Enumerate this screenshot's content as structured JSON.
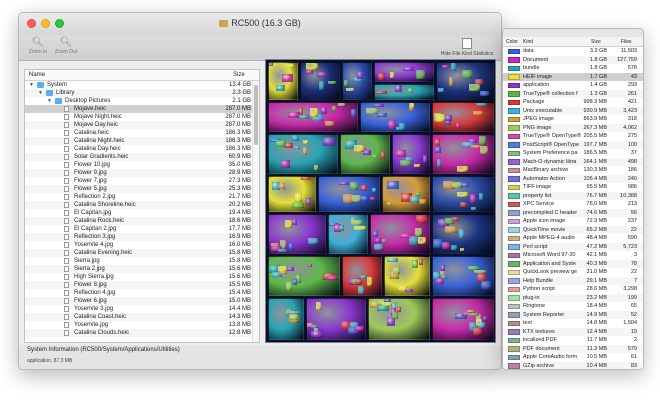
{
  "window": {
    "title": "RC500 (16.3 GB)"
  },
  "toolbar": {
    "zoom_in_label": "Zoom In",
    "zoom_out_label": "Zoom Out",
    "hide_kind_stats_label": "Hide File Kind Statistics"
  },
  "tree": {
    "header": {
      "name": "Name",
      "size": "Size"
    },
    "rows": [
      {
        "depth": 0,
        "type": "folder",
        "name": "System",
        "size": "13.4 GB",
        "twisty": "▼"
      },
      {
        "depth": 1,
        "type": "folder",
        "name": "Library",
        "size": "2.3 GB",
        "twisty": "▼"
      },
      {
        "depth": 2,
        "type": "folder",
        "name": "Desktop Pictures",
        "size": "2.1 GB",
        "twisty": "▼"
      },
      {
        "depth": 3,
        "type": "file",
        "name": "Mojave.heic",
        "size": "287.0 MB"
      },
      {
        "depth": 3,
        "type": "file",
        "name": "Mojave Night.heic",
        "size": "287.0 MB"
      },
      {
        "depth": 3,
        "type": "file",
        "name": "Mojave Day.heic",
        "size": "287.0 MB"
      },
      {
        "depth": 3,
        "type": "file",
        "name": "Catalina.heic",
        "size": "186.3 MB"
      },
      {
        "depth": 3,
        "type": "file",
        "name": "Catalina Night.heic",
        "size": "186.3 MB"
      },
      {
        "depth": 3,
        "type": "file",
        "name": "Catalina Day.heic",
        "size": "186.3 MB"
      },
      {
        "depth": 3,
        "type": "file",
        "name": "Solar Gradients.heic",
        "size": "60.9 MB"
      },
      {
        "depth": 3,
        "type": "file",
        "name": "Flower 10.jpg",
        "size": "35.0 MB"
      },
      {
        "depth": 3,
        "type": "file",
        "name": "Flower 9.jpg",
        "size": "28.9 MB"
      },
      {
        "depth": 3,
        "type": "file",
        "name": "Flower 7.jpg",
        "size": "27.3 MB"
      },
      {
        "depth": 3,
        "type": "file",
        "name": "Flower 5.jpg",
        "size": "25.3 MB"
      },
      {
        "depth": 3,
        "type": "file",
        "name": "Reflection 2.jpg",
        "size": "21.7 MB"
      },
      {
        "depth": 3,
        "type": "file",
        "name": "Catalina Shoreline.heic",
        "size": "20.2 MB"
      },
      {
        "depth": 3,
        "type": "file",
        "name": "El Capitan.jpg",
        "size": "19.4 MB"
      },
      {
        "depth": 3,
        "type": "file",
        "name": "Catalina Rock.heic",
        "size": "18.6 MB"
      },
      {
        "depth": 3,
        "type": "file",
        "name": "El Capitan 2.jpg",
        "size": "17.7 MB"
      },
      {
        "depth": 3,
        "type": "file",
        "name": "Reflection 3.jpg",
        "size": "16.9 MB"
      },
      {
        "depth": 3,
        "type": "file",
        "name": "Yosemite 4.jpg",
        "size": "16.0 MB"
      },
      {
        "depth": 3,
        "type": "file",
        "name": "Catalina Evening.heic",
        "size": "15.8 MB"
      },
      {
        "depth": 3,
        "type": "file",
        "name": "Sierra.jpg",
        "size": "15.8 MB"
      },
      {
        "depth": 3,
        "type": "file",
        "name": "Sierra 2.jpg",
        "size": "15.6 MB"
      },
      {
        "depth": 3,
        "type": "file",
        "name": "High Sierra.jpg",
        "size": "15.6 MB"
      },
      {
        "depth": 3,
        "type": "file",
        "name": "Flower 8.jpg",
        "size": "15.5 MB"
      },
      {
        "depth": 3,
        "type": "file",
        "name": "Reflection 4.jpg",
        "size": "15.4 MB"
      },
      {
        "depth": 3,
        "type": "file",
        "name": "Flower 6.jpg",
        "size": "15.0 MB"
      },
      {
        "depth": 3,
        "type": "file",
        "name": "Yosemite 3.jpg",
        "size": "14.4 MB"
      },
      {
        "depth": 3,
        "type": "file",
        "name": "Catalina Coast.heic",
        "size": "14.3 MB"
      },
      {
        "depth": 3,
        "type": "file",
        "name": "Yosemite.jpg",
        "size": "13.8 MB"
      },
      {
        "depth": 3,
        "type": "file",
        "name": "Catalina Clouds.heic",
        "size": "12.8 MB"
      }
    ]
  },
  "status": {
    "path": "System Information (RC500/System/Applications/Utilities)",
    "detail": "application, 87.3 MB"
  },
  "kinds": {
    "header": {
      "color": "Color",
      "kind": "Kind",
      "size": "Size",
      "files": "Files"
    },
    "rows": [
      {
        "color": "#3a62d8",
        "kind": "data",
        "size": "3.3 GB",
        "files": "11,503"
      },
      {
        "color": "#c72aa8",
        "kind": "Document",
        "size": "1.8 GB",
        "files": "127,759"
      },
      {
        "color": "#2aa3b3",
        "kind": "bundle",
        "size": "1.8 GB",
        "files": "578"
      },
      {
        "color": "#e4e13a",
        "kind": "HEIF image",
        "size": "1.7 GB",
        "files": "43"
      },
      {
        "color": "#8a37cf",
        "kind": "application",
        "size": "1.4 GB",
        "files": "293"
      },
      {
        "color": "#5fb74a",
        "kind": "TrueType® collection f",
        "size": "1.3 GB",
        "files": "261"
      },
      {
        "color": "#d83a3a",
        "kind": "Package",
        "size": "998.3 MB",
        "files": "421"
      },
      {
        "color": "#3fb0d6",
        "kind": "Unix executable",
        "size": "930.9 MB",
        "files": "3,423"
      },
      {
        "color": "#d89a3a",
        "kind": "JPEG image",
        "size": "863.9 MB",
        "files": "318"
      },
      {
        "color": "#a0c95a",
        "kind": "PNG image",
        "size": "267.3 MB",
        "files": "4,062"
      },
      {
        "color": "#c64fb0",
        "kind": "TrueType® OpenType®",
        "size": "205.5 MB",
        "files": "275"
      },
      {
        "color": "#4f7fd0",
        "kind": "PostScript® OpenType",
        "size": "197.7 MB",
        "files": "100"
      },
      {
        "color": "#7fbf7f",
        "kind": "System Preference pa",
        "size": "186.5 MB",
        "files": "37"
      },
      {
        "color": "#9a5fd0",
        "kind": "Mach-O dynamic libra",
        "size": "164.1 MB",
        "files": "498"
      },
      {
        "color": "#cf8fa0",
        "kind": "MacBinary archive",
        "size": "130.3 MB",
        "files": "186"
      },
      {
        "color": "#6f6fd8",
        "kind": "Automator Action",
        "size": "105.4 MB",
        "files": "240"
      },
      {
        "color": "#d0d060",
        "kind": "TIFF image",
        "size": "95.5 MB",
        "files": "986"
      },
      {
        "color": "#60c0a0",
        "kind": "property list",
        "size": "76.7 MB",
        "files": "10,388"
      },
      {
        "color": "#c06060",
        "kind": "XPC Service",
        "size": "76.0 MB",
        "files": "213"
      },
      {
        "color": "#8fa0d0",
        "kind": "precompiled C header",
        "size": "74.6 MB",
        "files": "56"
      },
      {
        "color": "#d0a0d0",
        "kind": "Apple icon image",
        "size": "72.9 MB",
        "files": "237"
      },
      {
        "color": "#a0d0d0",
        "kind": "QuickTime movie",
        "size": "65.2 MB",
        "files": "22"
      },
      {
        "color": "#d0b080",
        "kind": "Apple MPEG-4 audio",
        "size": "48.4 MB",
        "files": "590"
      },
      {
        "color": "#80b0e0",
        "kind": "Perl script",
        "size": "47.2 MB",
        "files": "5,723"
      },
      {
        "color": "#b070b0",
        "kind": "Microsoft Word 97-20",
        "size": "42.1 MB",
        "files": "3"
      },
      {
        "color": "#70b070",
        "kind": "Application and Syste",
        "size": "40.3 MB",
        "files": "78"
      },
      {
        "color": "#e0e0a0",
        "kind": "QuickLook preview ge",
        "size": "31.0 MB",
        "files": "22"
      },
      {
        "color": "#a0a0e0",
        "kind": "Help Bundle",
        "size": "29.1 MB",
        "files": "7"
      },
      {
        "color": "#e0a0a0",
        "kind": "Python script",
        "size": "28.6 MB",
        "files": "3,298"
      },
      {
        "color": "#a0e0a0",
        "kind": "plug-in",
        "size": "23.2 MB",
        "files": "199"
      },
      {
        "color": "#c0c0c0",
        "kind": "Ringtone",
        "size": "18.4 MB",
        "files": "65"
      },
      {
        "color": "#90a0b0",
        "kind": "System Reporter",
        "size": "14.9 MB",
        "files": "52"
      },
      {
        "color": "#b09080",
        "kind": "text",
        "size": "14.8 MB",
        "files": "1,504"
      },
      {
        "color": "#9080b0",
        "kind": "KTX textures",
        "size": "12.4 MB",
        "files": "19"
      },
      {
        "color": "#80b090",
        "kind": "localized PDF",
        "size": "11.7 MB",
        "files": "2"
      },
      {
        "color": "#b0b080",
        "kind": "PDF document",
        "size": "11.3 MB",
        "files": "579"
      },
      {
        "color": "#80a0c0",
        "kind": "Apple CoreAudio form",
        "size": "10.5 MB",
        "files": "61"
      },
      {
        "color": "#c080a0",
        "kind": "GZip archive",
        "size": "10.4 MB",
        "files": "83"
      }
    ]
  },
  "colors": {
    "treemap_bg": "#081028",
    "selection": "#d0d0d0",
    "folder": "#5aaef0"
  }
}
